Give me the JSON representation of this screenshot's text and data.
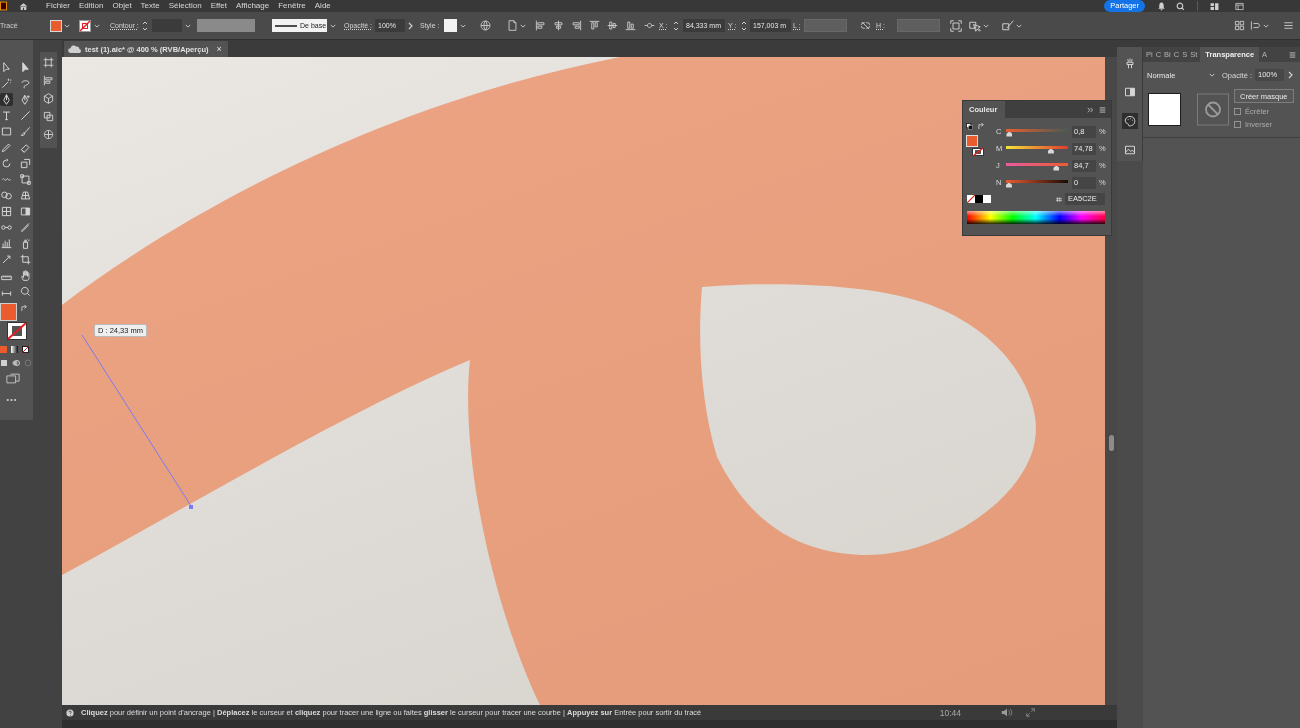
{
  "menu_bar": {
    "items": [
      "Fichier",
      "Edition",
      "Objet",
      "Texte",
      "Sélection",
      "Effet",
      "Affichage",
      "Fenêtre",
      "Aide"
    ],
    "share_button": "Partager"
  },
  "control_bar": {
    "tool_name": "Tracé",
    "stroke_label": "Contour :",
    "profile": "De base",
    "opacity_label": "Opacité :",
    "opacity": "100%",
    "style_label": "Style :",
    "x_label": "X :",
    "x_value": "84,333 mm",
    "y_label": "Y :",
    "y_value": "157,003 m",
    "width_label": "L :",
    "height_label": "H :"
  },
  "tools": [
    {
      "selected": false
    },
    {
      "selected": false
    },
    {
      "selected": false
    },
    {
      "selected": false
    },
    {
      "selected": true
    },
    {
      "selected": false
    },
    {
      "selected": false
    },
    {
      "selected": false
    },
    {
      "selected": false
    },
    {
      "selected": false
    },
    {
      "selected": false
    },
    {
      "selected": false
    },
    {
      "selected": false
    },
    {
      "selected": false
    },
    {
      "selected": false
    },
    {
      "selected": false
    },
    {
      "selected": false
    },
    {
      "selected": false
    },
    {
      "selected": false
    },
    {
      "selected": false
    },
    {
      "selected": false
    },
    {
      "selected": false
    },
    {
      "selected": false
    },
    {
      "selected": false
    },
    {
      "selected": false
    },
    {
      "selected": false
    },
    {
      "selected": false
    },
    {
      "selected": false
    },
    {
      "selected": false
    },
    {
      "selected": false
    }
  ],
  "document_tab": {
    "title": "test (1).aic* @ 400 % (RVB/Aperçu)",
    "close": "×"
  },
  "canvas": {
    "measure_tooltip": "D : 24,33 mm"
  },
  "color_panel": {
    "title": "Couleur",
    "channels": [
      {
        "name": "C",
        "value": "0,8",
        "unit": "%",
        "level": 0.008
      },
      {
        "name": "M",
        "value": "74,78",
        "unit": "%",
        "level": 0.7478
      },
      {
        "name": "J",
        "value": "84,7",
        "unit": "%",
        "level": 0.847
      },
      {
        "name": "N",
        "value": "0",
        "unit": "%",
        "level": 0
      }
    ],
    "hex": "EA5C2E"
  },
  "panel_dock": [
    {
      "selected": false
    },
    {
      "selected": false
    },
    {
      "selected": true
    },
    {
      "selected": false
    }
  ],
  "transparency_panel": {
    "tabs": [
      {
        "label": "Pi",
        "selected": false
      },
      {
        "label": "C",
        "selected": false
      },
      {
        "label": "Bi",
        "selected": false
      },
      {
        "label": "C",
        "selected": false
      },
      {
        "label": "S",
        "selected": false
      },
      {
        "label": "St",
        "selected": false
      },
      {
        "label": "Transparence",
        "selected": true
      },
      {
        "label": "A",
        "selected": false
      }
    ],
    "blend_mode": "Normale",
    "opacity_label": "Opacité :",
    "opacity": "100%",
    "mask_button": "Créer masque",
    "options": [
      {
        "label": "Écrêter",
        "checked": false,
        "disabled": true
      },
      {
        "label": "Inverser",
        "checked": false,
        "disabled": true
      }
    ]
  },
  "status_bar": {
    "hint": "**Cliquez** pour définir un point d'ancrage | **Déplacez** le curseur et **cliquez** pour tracer une ligne ou faites **glisser** le curseur pour tracer une courbe | **Appuyez sur** Entrée pour sortir du tracé"
  },
  "video_overlay": {
    "time": "10:44"
  }
}
